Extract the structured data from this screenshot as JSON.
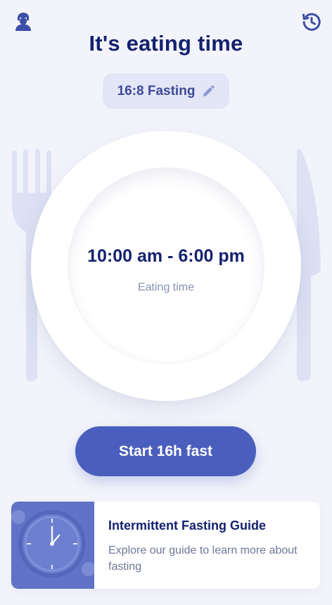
{
  "header": {
    "title": "It's eating time",
    "profile_icon": "profile-icon",
    "history_icon": "history-icon"
  },
  "plan": {
    "label": "16:8 Fasting",
    "edit_icon": "pencil-icon"
  },
  "plate": {
    "eating_window": "10:00 am - 6:00 pm",
    "caption": "Eating time"
  },
  "action": {
    "start_label": "Start 16h fast"
  },
  "guide": {
    "title": "Intermittent Fasting Guide",
    "description": "Explore our guide to learn more about fasting"
  },
  "colors": {
    "background": "#f3f4fb",
    "primary": "#4a5fbd",
    "title": "#14216f",
    "pill": "#e3e6f6",
    "cutlery": "#dde1f3"
  }
}
